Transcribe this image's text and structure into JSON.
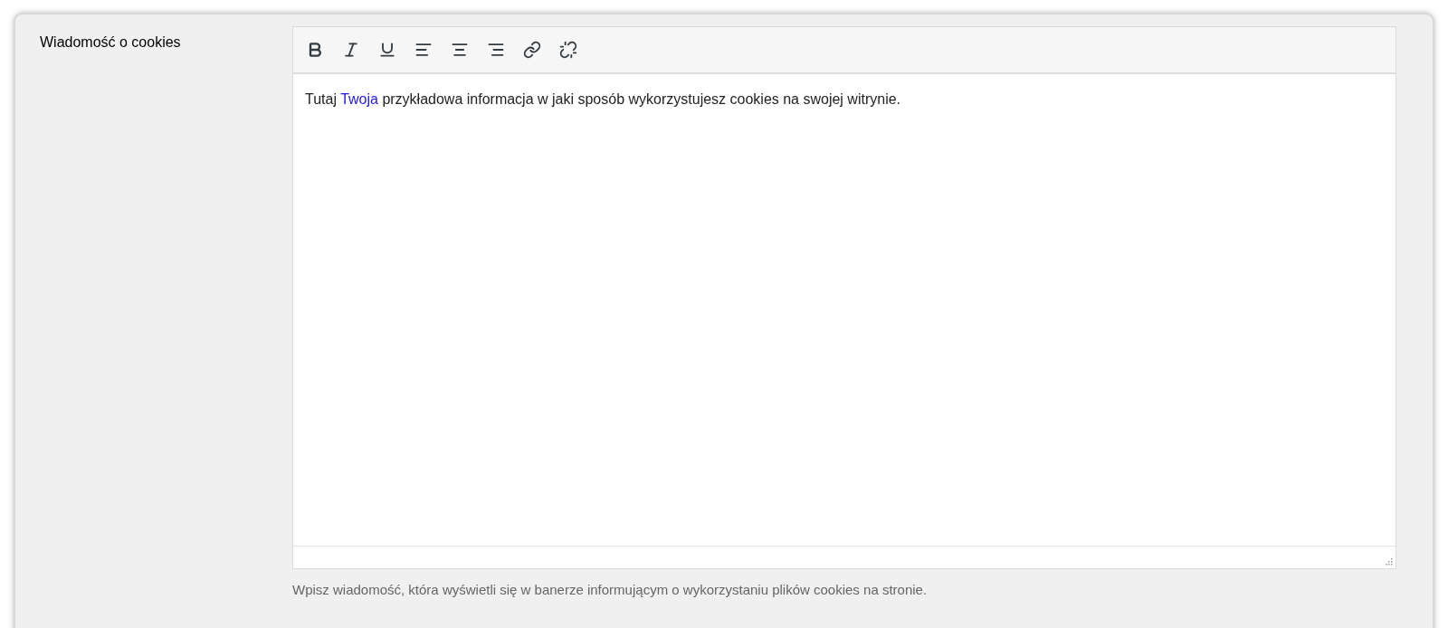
{
  "field": {
    "label": "Wiadomość o cookies"
  },
  "editor": {
    "toolbar": [
      {
        "kind": "bold"
      },
      {
        "kind": "italic"
      },
      {
        "kind": "underline"
      },
      {
        "kind": "align-left"
      },
      {
        "kind": "align-center"
      },
      {
        "kind": "align-right"
      },
      {
        "kind": "link"
      },
      {
        "kind": "unlink"
      }
    ],
    "content": [
      {
        "kind": "plain",
        "text": "Tutaj "
      },
      {
        "kind": "link",
        "text": "Twoja"
      },
      {
        "kind": "plain",
        "text": " przykładowa informacja w jaki sposób wykorzystujesz cookies na swojej witrynie."
      }
    ]
  },
  "help_text": "Wpisz wiadomość, która wyświetli się w banerze informującym o wykorzystaniu plików cookies na stronie."
}
